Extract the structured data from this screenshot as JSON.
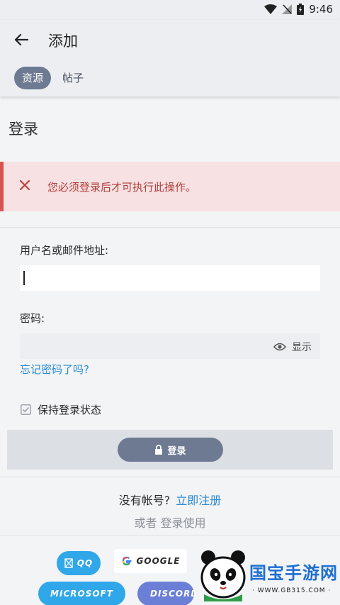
{
  "status_bar": {
    "time": "9:46"
  },
  "app_bar": {
    "title": "添加",
    "tabs": [
      {
        "label": "资源",
        "active": true
      },
      {
        "label": "帖子",
        "active": false
      }
    ]
  },
  "page": {
    "title": "登录"
  },
  "alert": {
    "message": "您必须登录后才可执行此操作。",
    "color": "#b13f3c"
  },
  "form": {
    "username_label": "用户名或邮件地址:",
    "username_value": "",
    "password_label": "密码:",
    "password_value": "",
    "show_password_label": "显示",
    "forgot_link": "忘记密码了吗?",
    "remember_label": "保持登录状态",
    "remember_checked": true,
    "login_button": "登录"
  },
  "register": {
    "prompt": "没有帐号?",
    "link": "立即注册",
    "or_text": "或者 登录使用"
  },
  "social": {
    "qq": "QQ",
    "google": "GOOGLE",
    "microsoft": "MICROSOFT",
    "discord": "DISCORD"
  },
  "watermark": {
    "title": "国宝手游网",
    "url": "· WWW.GB315.COM ·"
  },
  "colors": {
    "accent": "#6d7a92",
    "link": "#2a8bd2",
    "brand_blue": "#2fa7e8",
    "discord": "#6b7fd7"
  }
}
